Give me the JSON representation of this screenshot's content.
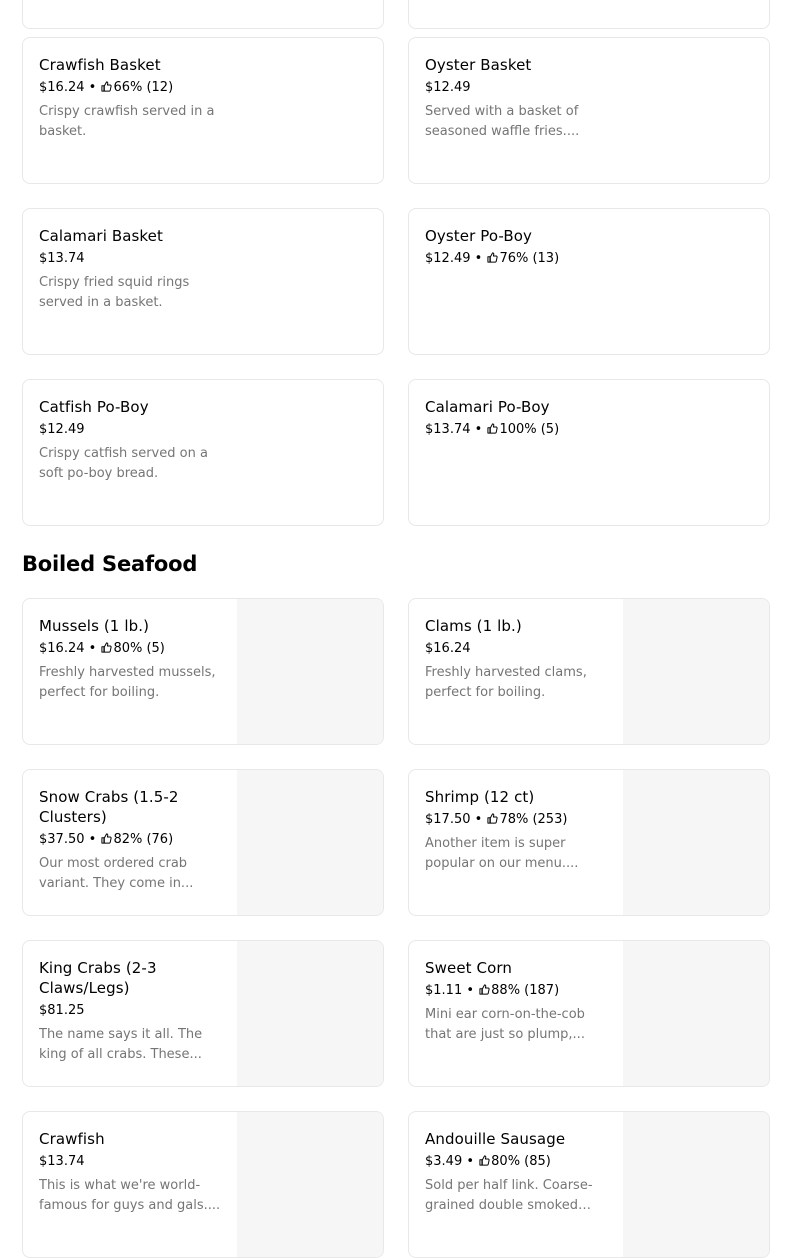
{
  "sections": [
    {
      "items": [
        {
          "title": "Crawfish Basket",
          "price": "$16.24",
          "rating": "66% (12)",
          "description": "Crispy crawfish served in a basket."
        },
        {
          "title": "Oyster Basket",
          "price": "$12.49",
          "rating": "",
          "description": "Served with a basket of seasoned waffle fries...."
        },
        {
          "title": "Calamari Basket",
          "price": "$13.74",
          "rating": "",
          "description": "Crispy fried squid rings served in a basket."
        },
        {
          "title": "Oyster Po-Boy",
          "price": "$12.49",
          "rating": "76% (13)",
          "description": ""
        },
        {
          "title": "Catfish Po-Boy",
          "price": "$12.49",
          "rating": "",
          "description": "Crispy catfish served on a soft po-boy bread."
        },
        {
          "title": "Calamari Po-Boy",
          "price": "$13.74",
          "rating": "100% (5)",
          "description": ""
        }
      ]
    },
    {
      "title": "Boiled Seafood",
      "items": [
        {
          "title": "Mussels (1 lb.)",
          "price": "$16.24",
          "rating": "80% (5)",
          "description": "Freshly harvested mussels, perfect for boiling."
        },
        {
          "title": "Clams (1 lb.)",
          "price": "$16.24",
          "rating": "",
          "description": "Freshly harvested clams, perfect for boiling."
        },
        {
          "title": "Snow Crabs (1.5-2 Clusters)",
          "price": "$37.50",
          "rating": "82% (76)",
          "description": "Our most ordered crab variant. They come in..."
        },
        {
          "title": "Shrimp (12 ct)",
          "price": "$17.50",
          "rating": "78% (253)",
          "description": "Another item is super popular on our menu...."
        },
        {
          "title": "King Crabs (2-3 Claws/Legs)",
          "price": "$81.25",
          "rating": "",
          "description": "The name says it all. The king of all crabs. These..."
        },
        {
          "title": "Sweet Corn",
          "price": "$1.11",
          "rating": "88% (187)",
          "description": "Mini ear corn-on-the-cob that are just so plump,..."
        },
        {
          "title": "Crawfish",
          "price": "$13.74",
          "rating": "",
          "description": "This is what we're world-famous for guys and gals...."
        },
        {
          "title": "Andouille Sausage",
          "price": "$3.49",
          "rating": "80% (85)",
          "description": "Sold per half link. Coarse-grained double smoked por..."
        }
      ]
    }
  ],
  "separator": " • ",
  "icons": {
    "rating": "thumbs-up-icon"
  },
  "colors": {
    "border": "#e8e8e8",
    "description": "#757575",
    "image_placeholder": "#f6f6f6",
    "text": "#000000"
  }
}
